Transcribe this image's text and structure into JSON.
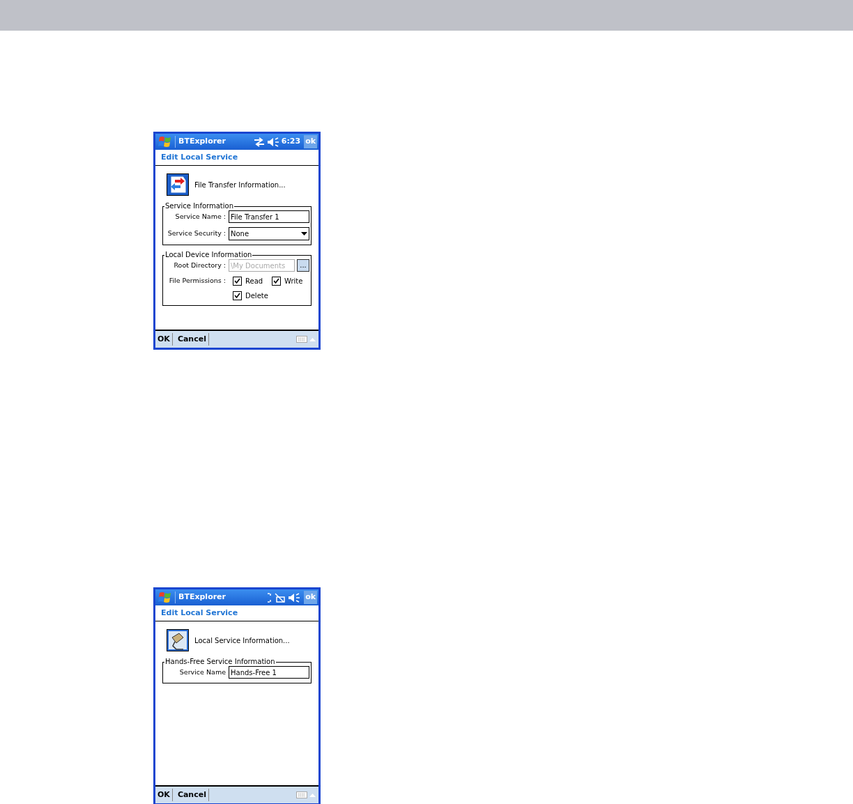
{
  "screens": [
    {
      "kind": "file-transfer",
      "title_bar": {
        "app": "BTExplorer",
        "time": "6:23",
        "ok": "ok"
      },
      "header": "Edit Local Service",
      "info": "File Transfer Information...",
      "groups": [
        {
          "legend": "Service Information",
          "rows": [
            {
              "kind": "text",
              "label": "Service Name :",
              "value": "File Transfer 1"
            },
            {
              "kind": "dropdown",
              "label": "Service Security :",
              "value": "None"
            }
          ]
        },
        {
          "legend": "Local Device Information",
          "rows": [
            {
              "kind": "browse",
              "label": "Root Directory :",
              "value": "\\My Documents",
              "disabled": true,
              "button": "..."
            },
            {
              "kind": "checks",
              "label": "File Permissions :",
              "options": [
                {
                  "label": "Read",
                  "checked": true
                },
                {
                  "label": "Write",
                  "checked": true
                },
                {
                  "label": "Delete",
                  "checked": true
                }
              ]
            }
          ]
        }
      ],
      "menu": [
        "OK",
        "Cancel"
      ]
    },
    {
      "kind": "hands-free",
      "title_bar": {
        "app": "BTExplorer",
        "ok": "ok"
      },
      "header": "Edit Local Service",
      "info": "Local Service Information...",
      "groups": [
        {
          "legend": "Hands-Free Service Information",
          "rows": [
            {
              "kind": "text",
              "label": "Service Name",
              "value": "Hands-Free 1"
            }
          ]
        }
      ],
      "menu": [
        "OK",
        "Cancel"
      ]
    }
  ]
}
